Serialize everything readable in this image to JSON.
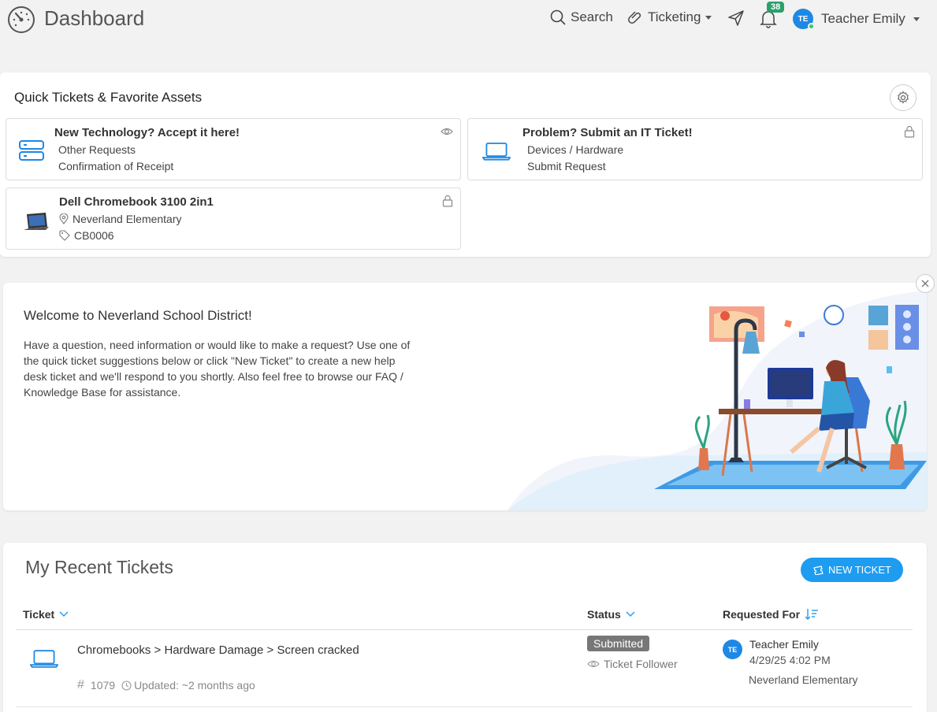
{
  "header": {
    "title": "Dashboard",
    "search_label": "Search",
    "ticketing_label": "Ticketing",
    "notification_count": "38",
    "user_initials": "TE",
    "user_name": "Teacher Emily"
  },
  "quick_tickets": {
    "title": "Quick Tickets & Favorite Assets",
    "tiles": [
      {
        "title": "New Technology? Accept it here!",
        "line1": "Other Requests",
        "line2": "Confirmation of Receipt",
        "icon": "server-icon",
        "corner_icon": "eye-icon"
      },
      {
        "title": "Problem? Submit an IT Ticket!",
        "line1": "Devices / Hardware",
        "line2": "Submit Request",
        "icon": "laptop-icon",
        "corner_icon": "lock-icon"
      },
      {
        "title": "Dell Chromebook 3100 2in1",
        "line1": "Neverland Elementary",
        "line2": "CB0006",
        "icon": "chromebook-image",
        "corner_icon": "lock-icon"
      }
    ]
  },
  "welcome": {
    "title": "Welcome to Neverland School District!",
    "body": "Have a question, need information or would like to make a request? Use one of the quick ticket suggestions below or click \"New Ticket\" to create a new help desk ticket and we'll respond to you shortly. Also feel free to browse our FAQ / Knowledge Base for assistance."
  },
  "recent_tickets": {
    "title": "My Recent Tickets",
    "new_ticket_label": "NEW TICKET",
    "columns": {
      "ticket": "Ticket",
      "status": "Status",
      "requested_for": "Requested For"
    },
    "rows": [
      {
        "title": "Chromebooks > Hardware Damage > Screen cracked",
        "number": "1079",
        "updated": "Updated: ~2 months ago",
        "status": "Submitted",
        "follower": "Ticket Follower",
        "requester_initials": "TE",
        "requester_name": "Teacher Emily",
        "requester_date": "4/29/25 4:02 PM",
        "requester_location": "Neverland Elementary"
      }
    ]
  },
  "colors": {
    "accent": "#1e9cf0",
    "badge_green": "#2aa06b",
    "status_gray": "#777777",
    "avatar_blue": "#1e88e5"
  }
}
